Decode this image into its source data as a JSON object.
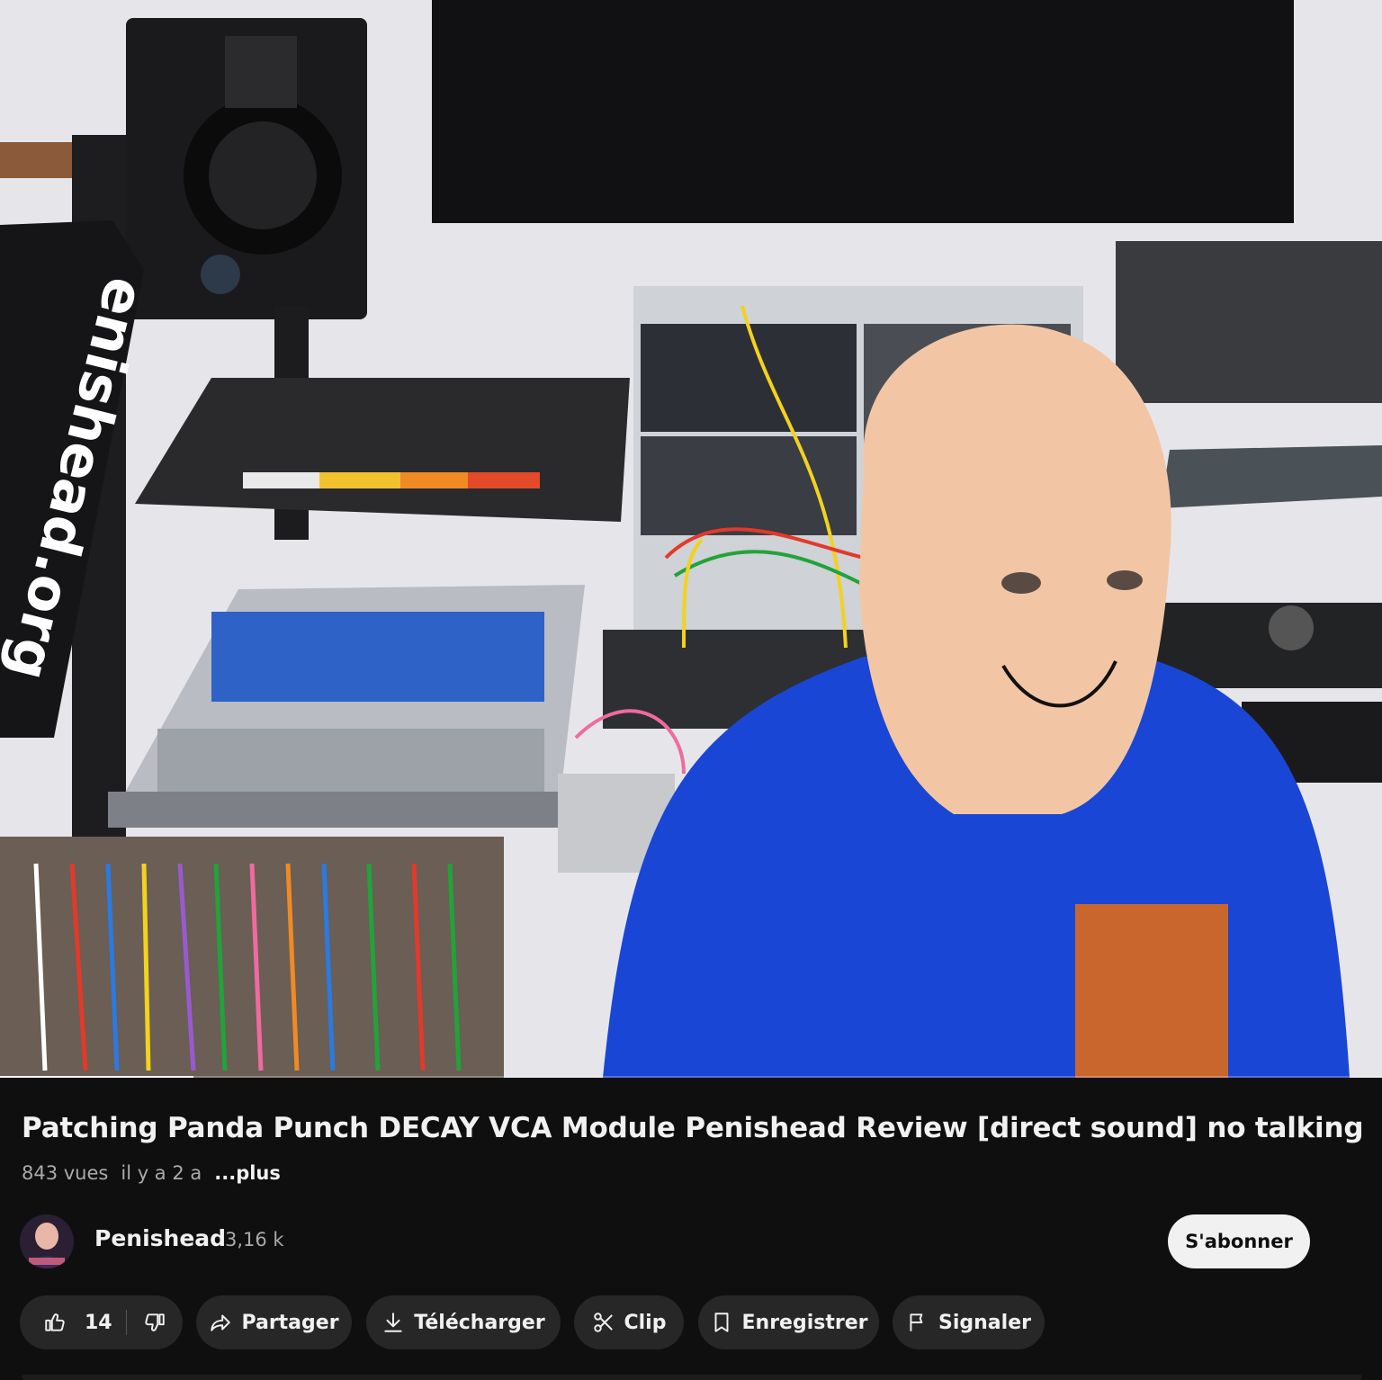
{
  "video": {
    "overlay_text": "enishead.org",
    "progress_fraction": 0.14
  },
  "title": "Patching Panda Punch DECAY VCA Module Penishead Review [direct sound] no talking",
  "meta": {
    "views": "843 vues",
    "age": "il y a 2 a",
    "more": "...plus"
  },
  "channel": {
    "name": "Penishead",
    "subscribers": "3,16 k",
    "subscribe_label": "S'abonner"
  },
  "actions": {
    "like_count": "14",
    "share_label": "Partager",
    "download_label": "Télécharger",
    "clip_label": "Clip",
    "save_label": "Enregistrer",
    "report_label": "Signaler"
  },
  "icons": {
    "like": "thumb-up-icon",
    "dislike": "thumb-down-icon",
    "share": "share-arrow-icon",
    "download": "download-icon",
    "clip": "scissors-icon",
    "save": "bookmark-icon",
    "report": "flag-icon"
  },
  "colors": {
    "background": "#0f0f0f",
    "pill": "#272727",
    "subscribe_bg": "#f1f1f1",
    "text_primary": "#f1f1f1",
    "text_secondary": "#aaaaaa"
  }
}
